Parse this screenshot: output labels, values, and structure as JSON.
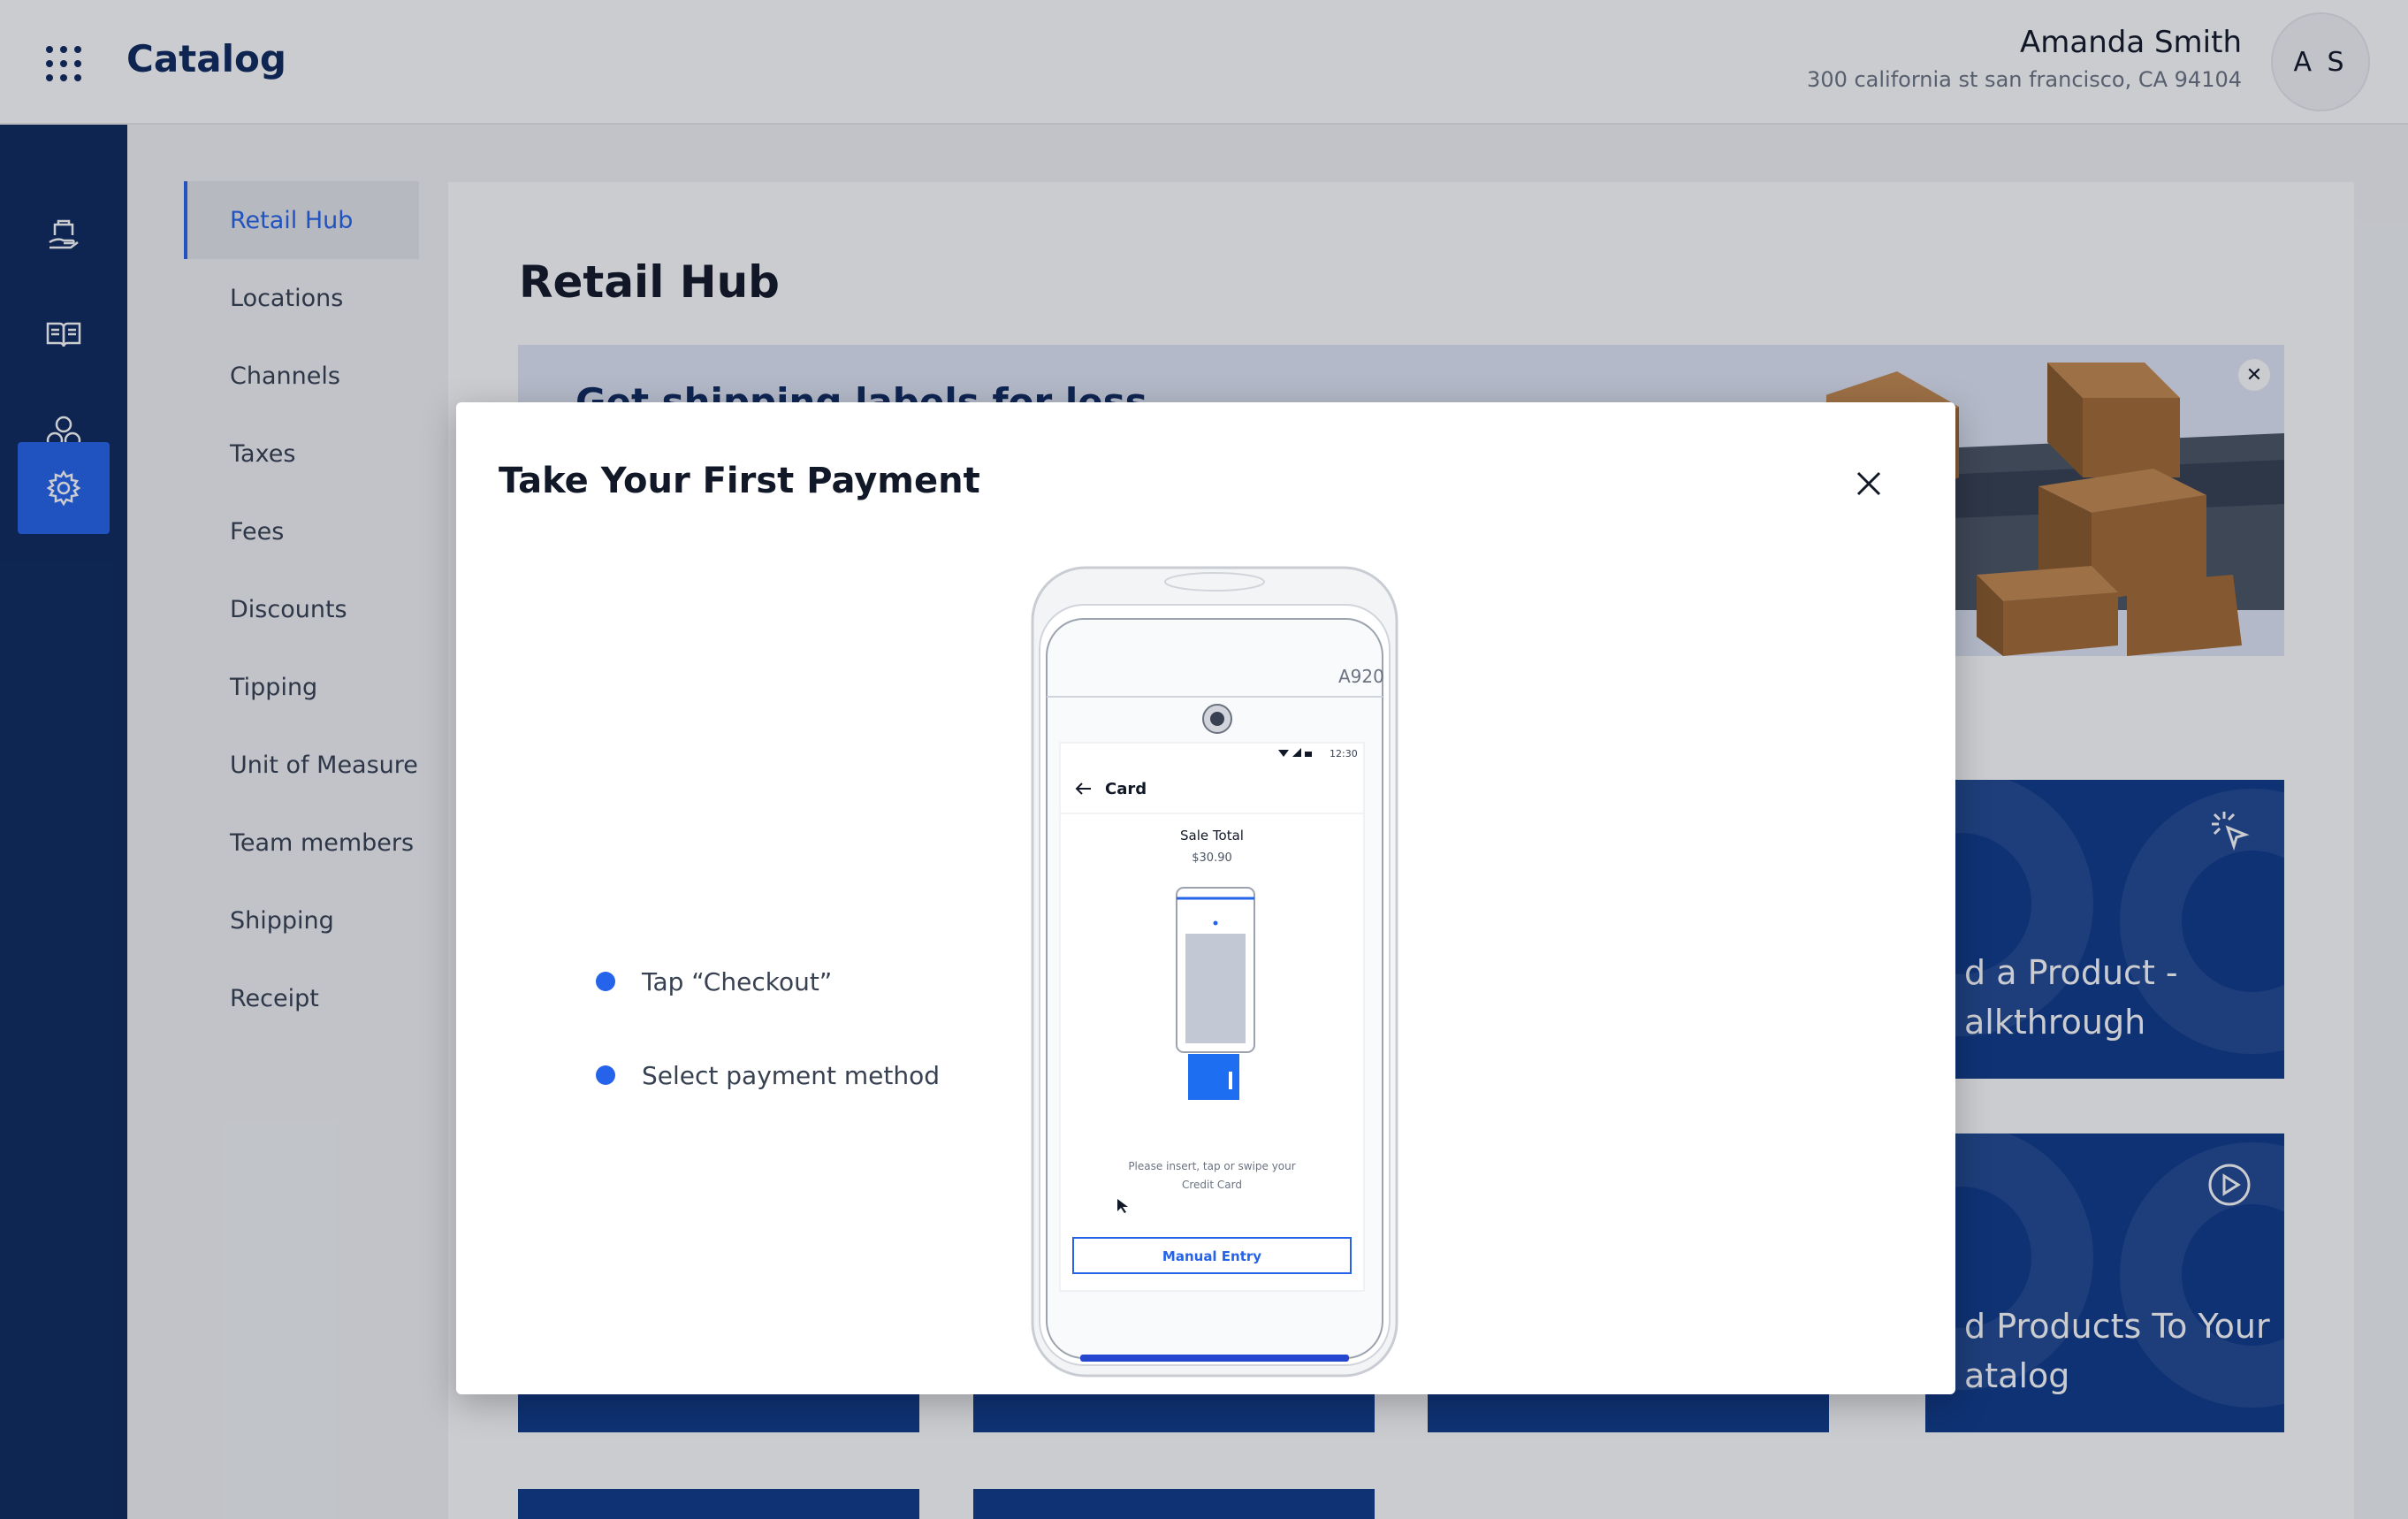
{
  "app": {
    "title": "Catalog"
  },
  "user": {
    "name": "Amanda Smith",
    "address": "300 california st san francisco, CA 94104",
    "initials": "A S"
  },
  "rail": {
    "items": [
      {
        "icon": "store-hand-icon"
      },
      {
        "icon": "catalog-book-icon"
      },
      {
        "icon": "circles-icon"
      },
      {
        "icon": "settings-gear-icon",
        "active": true
      }
    ]
  },
  "subnav": {
    "items": [
      {
        "label": "Retail Hub",
        "active": true
      },
      {
        "label": "Locations"
      },
      {
        "label": "Channels"
      },
      {
        "label": "Taxes"
      },
      {
        "label": "Fees"
      },
      {
        "label": "Discounts"
      },
      {
        "label": "Tipping"
      },
      {
        "label": "Unit of Measure"
      },
      {
        "label": "Team members"
      },
      {
        "label": "Shipping"
      },
      {
        "label": "Receipt"
      }
    ]
  },
  "main": {
    "title": "Retail Hub",
    "banner_title": "Get shipping labels for less",
    "cards": [
      {
        "text_line1": "d a Product -",
        "text_line2": "alkthrough",
        "icon": "cursor-click-icon"
      },
      {
        "text_line1": "d Products To Your",
        "text_line2": "atalog",
        "icon": "play-circle-icon"
      }
    ]
  },
  "modal": {
    "title": "Take Your First Payment",
    "steps": [
      "Tap “Checkout”",
      "Select payment  method"
    ],
    "device": {
      "model": "A920",
      "time": "12:30",
      "screen_title": "Card",
      "sale_label": "Sale Total",
      "sale_amount": "$30.90",
      "instruction_line1": "Please insert, tap or swipe your",
      "instruction_line2": "Credit Card",
      "button_label": "Manual Entry"
    }
  },
  "colors": {
    "navy": "#0d2a5e",
    "accent": "#2563eb",
    "card": "#0f3a8a"
  }
}
